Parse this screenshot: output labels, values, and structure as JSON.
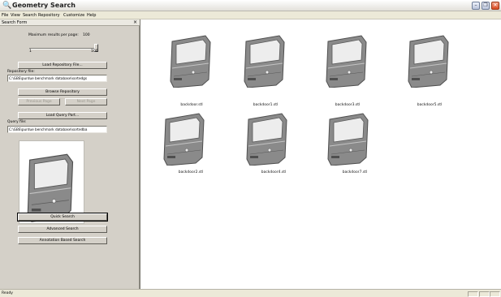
{
  "window": {
    "title": "Geometry Search",
    "minimize": "–",
    "maximize": "❐",
    "close": "✕"
  },
  "menu": [
    "File",
    "View",
    "Search",
    "Repository",
    "Customize",
    "Help"
  ],
  "panel": {
    "title": "Search Form",
    "close_glyph": "×",
    "max_results_label": "Maximum results per page:",
    "max_results_value": "100",
    "slider_min": "1",
    "slider_max": "100",
    "slider_level_fraction": 1.0,
    "load_repository_button": "Load Repository File...",
    "repository_file_label": "Repository file:",
    "repository_file_value": "C:\\GBS\\purdue benchmark database\\sortedgs",
    "browse_repository_button": "Browse Repository",
    "previous_page_button": "Previous Page",
    "next_page_button": "Next Page",
    "load_query_button": "Load Query Part...",
    "query_file_label": "Query file:",
    "query_file_value": "C:\\GBS\\purdue benchmark database\\sortedba",
    "quick_search_button": "Quick Search",
    "advanced_search_button": "Advanced Search",
    "annotation_search_button": "Annotation Based Search"
  },
  "results": [
    {
      "name": "backdoor.stl"
    },
    {
      "name": "backdoor1.stl"
    },
    {
      "name": "backdoor3.stl"
    },
    {
      "name": "backdoor5.stl"
    },
    {
      "name": "backdoor2.stl"
    },
    {
      "name": "backdoor4.stl"
    },
    {
      "name": "backdoor7.stl"
    }
  ],
  "status": {
    "text": "Ready"
  },
  "colors": {
    "part_fill": "#8a8a8a",
    "part_dark": "#4f4f4f",
    "part_light": "#c4c4c4",
    "window_fill": "#ededed"
  }
}
